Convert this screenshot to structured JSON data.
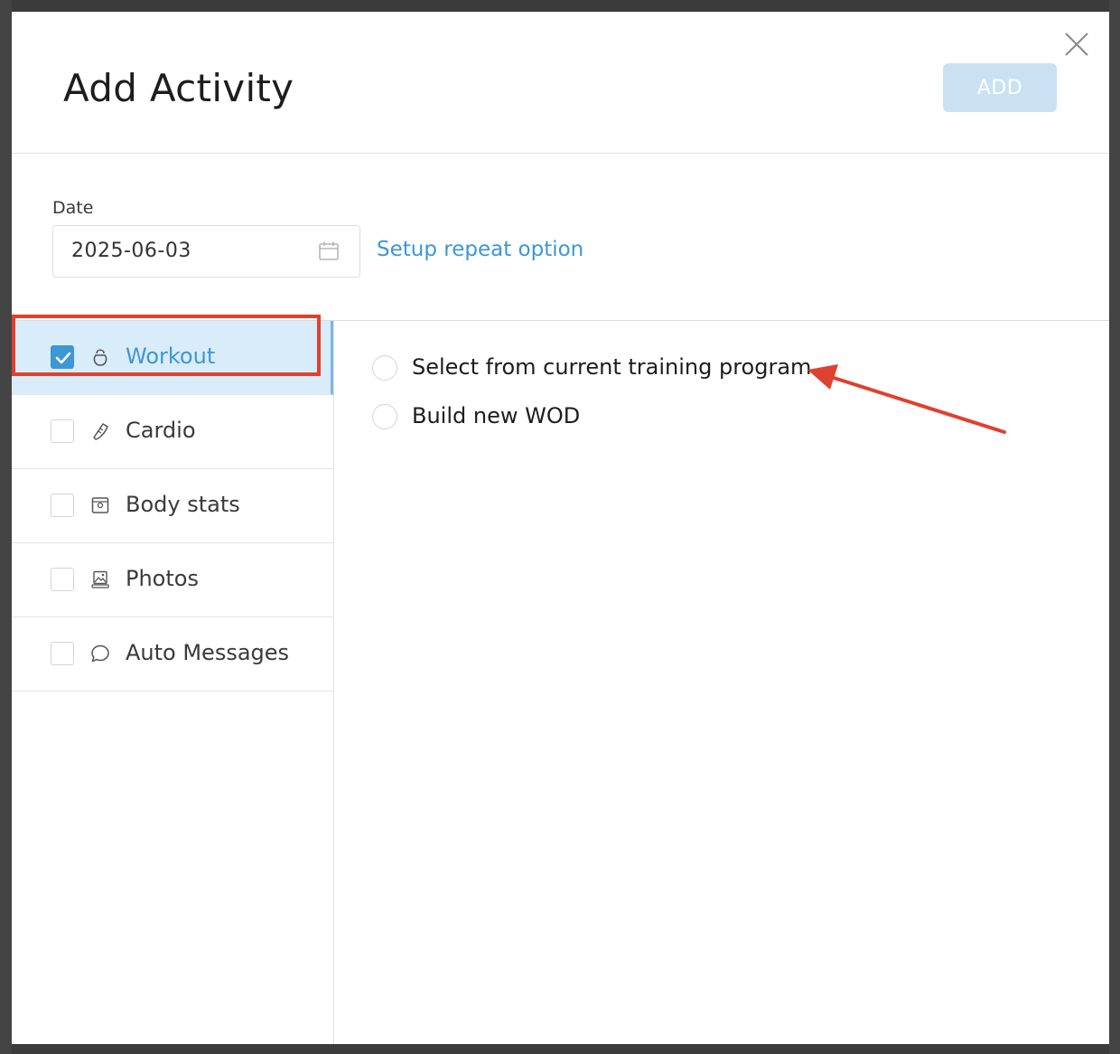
{
  "modal": {
    "title": "Add Activity",
    "add_label": "ADD",
    "close_icon": "close-icon"
  },
  "date": {
    "label": "Date",
    "value": "2025-06-03",
    "calendar_icon": "calendar-icon",
    "repeat_link": "Setup repeat option"
  },
  "sidebar": {
    "items": [
      {
        "label": "Workout",
        "icon": "kettlebell-icon",
        "checked": true,
        "active": true
      },
      {
        "label": "Cardio",
        "icon": "running-shoe-icon",
        "checked": false,
        "active": false
      },
      {
        "label": "Body stats",
        "icon": "scale-icon",
        "checked": false,
        "active": false
      },
      {
        "label": "Photos",
        "icon": "photo-icon",
        "checked": false,
        "active": false
      },
      {
        "label": "Auto Messages",
        "icon": "chat-bubble-icon",
        "checked": false,
        "active": false
      }
    ]
  },
  "workout_options": [
    {
      "label": "Select from current training program",
      "selected": false
    },
    {
      "label": "Build new WOD",
      "selected": false
    }
  ],
  "colors": {
    "accent": "#3d97d3",
    "active_bg": "#d9ecf9",
    "add_button_disabled": "#c9e1f3",
    "annotation": "#e0402f"
  }
}
